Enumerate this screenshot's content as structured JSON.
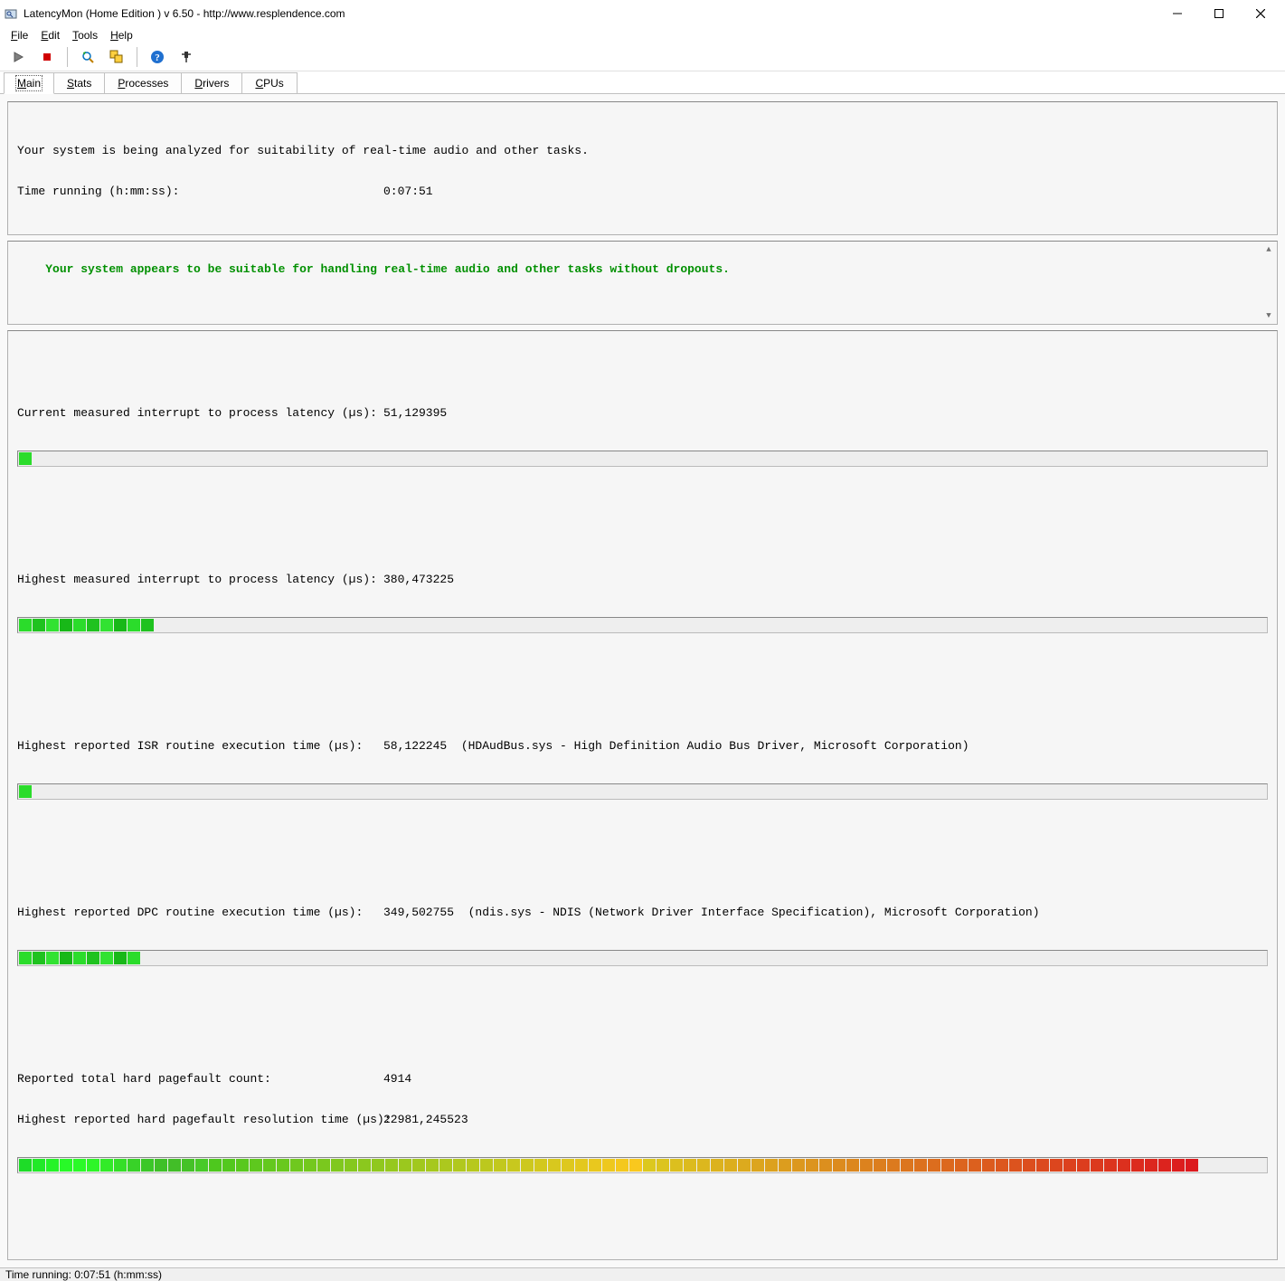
{
  "window": {
    "title": "LatencyMon  (Home Edition )  v 6.50 - http://www.resplendence.com"
  },
  "menus": {
    "file": "File",
    "edit": "Edit",
    "tools": "Tools",
    "help": "Help"
  },
  "tabs": {
    "main": "Main",
    "stats": "Stats",
    "processes": "Processes",
    "drivers": "Drivers",
    "cpus": "CPUs"
  },
  "header": {
    "line1": "Your system is being analyzed for suitability of real-time audio and other tasks.",
    "line2_label": "Time running (h:mm:ss):",
    "line2_value": "0:07:51"
  },
  "status": {
    "message": "Your system appears to be suitable for handling real-time audio and other tasks without dropouts."
  },
  "metrics": {
    "m1": {
      "label": "Current measured interrupt to process latency (µs):",
      "value": "51,129395",
      "segments": 1
    },
    "m2": {
      "label": "Highest measured interrupt to process latency (µs):",
      "value": "380,473225",
      "segments": 10
    },
    "m3": {
      "label": "Highest reported ISR routine execution time (µs):",
      "value": "58,122245  (HDAudBus.sys - High Definition Audio Bus Driver, Microsoft Corporation)",
      "segments": 1
    },
    "m4": {
      "label": "Highest reported DPC routine execution time (µs):",
      "value": "349,502755  (ndis.sys - NDIS (Network Driver Interface Specification), Microsoft Corporation)",
      "segments": 9
    },
    "m5a": {
      "label": "Reported total hard pagefault count:",
      "value": "4914"
    },
    "m5b": {
      "label": "Highest reported hard pagefault resolution time (µs):",
      "value": "22981,245523",
      "segments": 87
    }
  },
  "statusbar": {
    "text": "Time running: 0:07:51  (h:mm:ss)"
  }
}
